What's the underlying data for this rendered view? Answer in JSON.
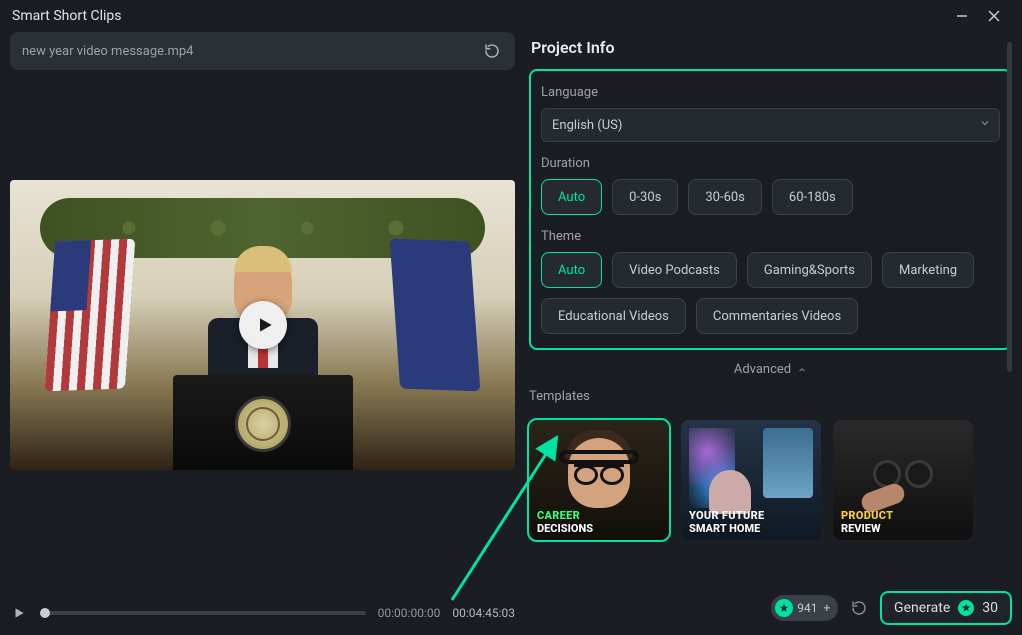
{
  "window": {
    "title": "Smart Short Clips"
  },
  "file": {
    "name": "new year video message.mp4"
  },
  "playback": {
    "position": "00:00:00:00",
    "duration": "00:04:45:03"
  },
  "project": {
    "heading": "Project Info",
    "language_label": "Language",
    "language_value": "English (US)",
    "duration_label": "Duration",
    "duration_options": [
      "Auto",
      "0-30s",
      "30-60s",
      "60-180s"
    ],
    "duration_selected": "Auto",
    "theme_label": "Theme",
    "theme_options": [
      "Auto",
      "Video Podcasts",
      "Gaming&Sports",
      "Marketing",
      "Educational Videos",
      "Commentaries Videos"
    ],
    "theme_selected": "Auto",
    "advanced_label": "Advanced"
  },
  "templates": {
    "heading": "Templates",
    "items": [
      {
        "line1": "CAREER",
        "line1_color": "#39ff7a",
        "line2": "DECISIONS",
        "selected": true
      },
      {
        "line1": "YOUR FUTURE",
        "line1_color": "#ffffff",
        "line2": "SMART HOME",
        "selected": false
      },
      {
        "line1": "PRODUCT",
        "line1_color": "#ffd23a",
        "line2": "REVIEW",
        "selected": false
      }
    ]
  },
  "credits": {
    "count": "941"
  },
  "generate": {
    "label": "Generate",
    "cost": "30"
  }
}
